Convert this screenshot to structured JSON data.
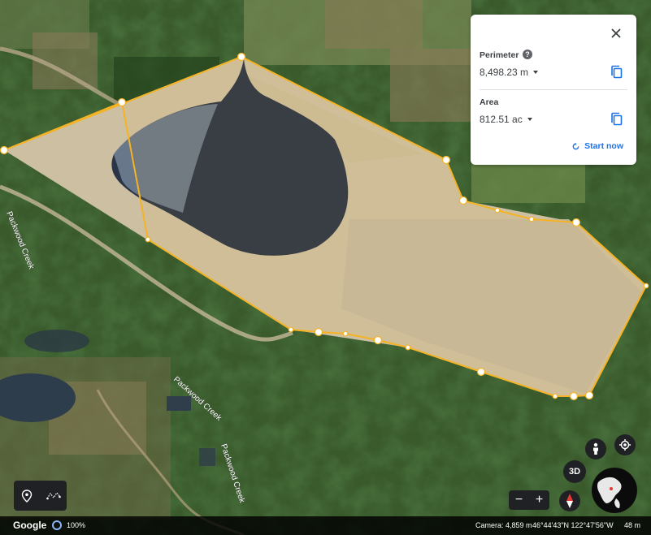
{
  "measure_panel": {
    "perimeter_label": "Perimeter",
    "perimeter_value": "8,498.23 m",
    "area_label": "Area",
    "area_value": "812.51 ac",
    "start_new_label": "Start now",
    "icons": {
      "close": "close-icon",
      "help": "help-icon",
      "copy": "copy-icon",
      "restart": "refresh-icon"
    },
    "accent_color": "#1a73e8"
  },
  "map": {
    "road_labels": [
      "Packwood Creek",
      "Packwood Creek",
      "Packwood Creek"
    ],
    "polygon_color": "#f5b324"
  },
  "controls": {
    "three_d_label": "3D",
    "zoom_out": "−",
    "zoom_in": "+",
    "icons": [
      "place-pin-icon",
      "path-icon",
      "pegman-icon",
      "my-location-icon",
      "compass-icon",
      "globe-icon"
    ]
  },
  "status_bar": {
    "logo": "Google",
    "zoom_pct": "100%",
    "camera": "Camera: 4,859 m",
    "coords": "46°44'43\"N 122°47'56\"W",
    "scale": "48 m"
  }
}
